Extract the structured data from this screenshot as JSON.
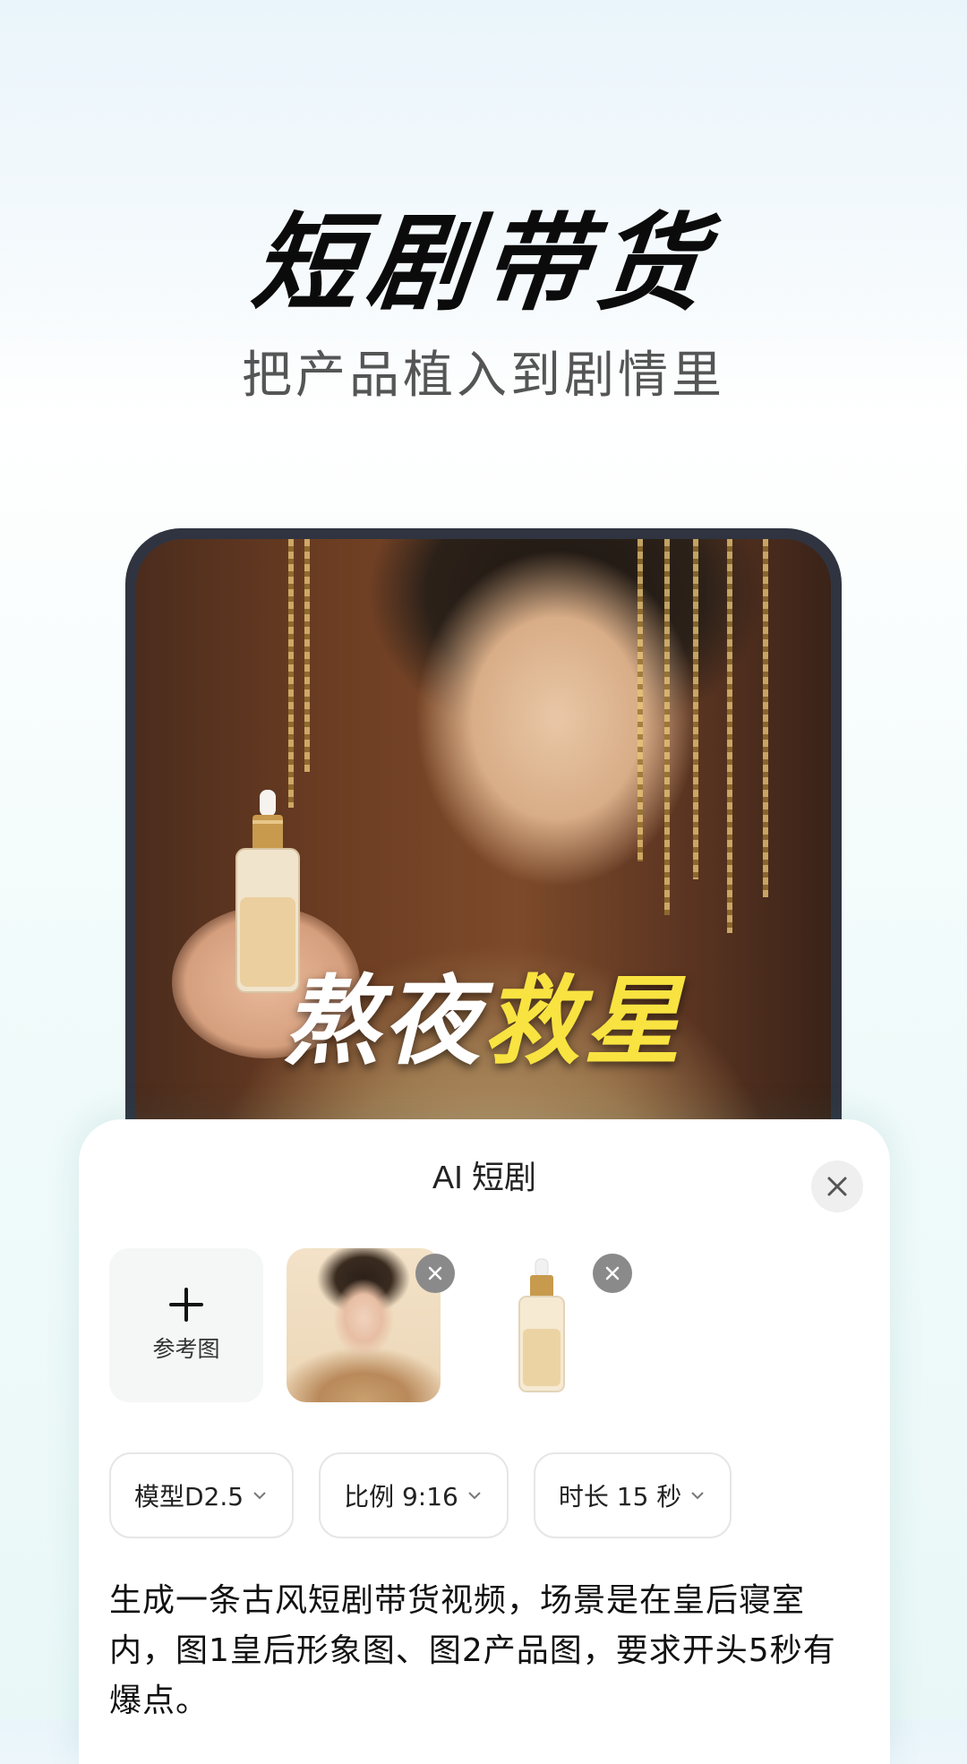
{
  "hero": {
    "title": "短剧带货",
    "subtitle": "把产品植入到剧情里"
  },
  "preview": {
    "caption_white": "熬夜",
    "caption_yellow": "救星"
  },
  "sheet": {
    "title": "AI 短剧",
    "add_ref_label": "参考图",
    "options": {
      "model": "模型D2.5",
      "ratio": "比例 9:16",
      "duration": "时长 15 秒"
    },
    "prompt": "生成一条古风短剧带货视频，场景是在皇后寝室内，图1皇后形象图、图2产品图，要求开头5秒有爆点。"
  },
  "icons": {
    "close": "close-icon",
    "remove": "remove-icon",
    "plus": "plus-icon",
    "chevron": "chevron-down-icon"
  },
  "colors": {
    "caption_yellow": "#f8e341",
    "frame": "#2f3440"
  }
}
